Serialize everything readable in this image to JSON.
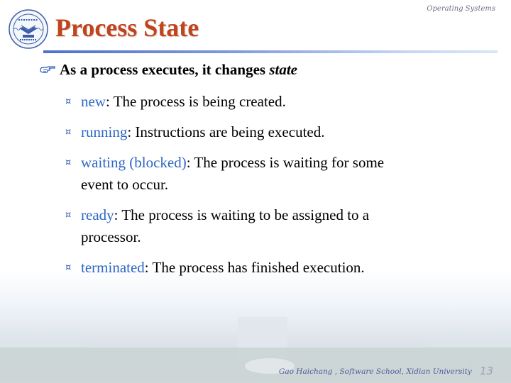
{
  "slide": {
    "title": "Process State",
    "course_label": "Operating Systems",
    "lead": {
      "text": "As a process executes, it changes ",
      "emphasis": "state",
      "icon": "pointing-hand-icon"
    },
    "bullet_icon": "currency-sign-bullet-icon",
    "items": [
      {
        "term": "new",
        "lines": [
          ": The process is being created."
        ]
      },
      {
        "term": "running",
        "lines": [
          ": Instructions are being executed."
        ]
      },
      {
        "term": "waiting (blocked)",
        "lines": [
          ": The process is waiting for some",
          "event to occur."
        ]
      },
      {
        "term": "ready",
        "lines": [
          ": The process is waiting to be assigned to a",
          "processor."
        ]
      },
      {
        "term": "terminated",
        "lines": [
          ": The process has finished execution."
        ]
      }
    ],
    "footer": {
      "author": "Gao Haichang , Software School, Xidian University",
      "page_number": "13"
    },
    "logo": "university-seal-logo"
  },
  "colors": {
    "title": "#c0441e",
    "term": "#2e67c4",
    "bullet": "#2f5fb5",
    "rule_start": "#4f71c9",
    "rule_end": "#d8e6f8"
  }
}
